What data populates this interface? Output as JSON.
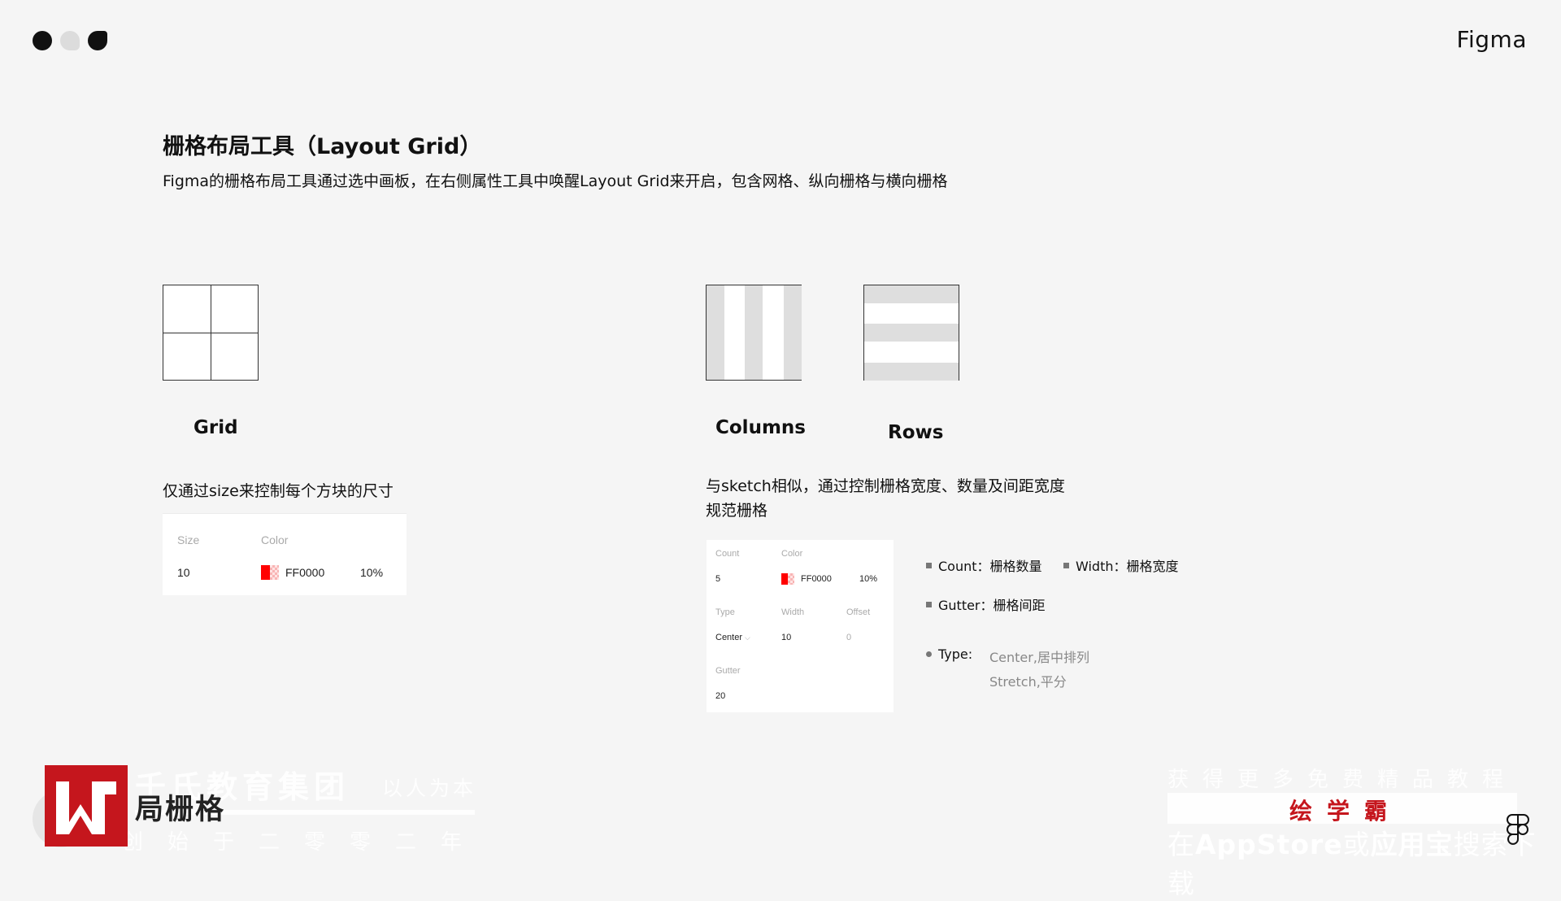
{
  "header": {
    "brand": "Figma"
  },
  "main": {
    "title": "栅格布局工具（Layout Grid）",
    "subtitle": "Figma的栅格布局工具通过选中画板，在右侧属性工具中唤醒Layout Grid来开启，包含网格、纵向栅格与横向栅格"
  },
  "grid_section": {
    "label": "Grid",
    "description": "仅通过size来控制每个方块的尺寸",
    "panel": {
      "size_label": "Size",
      "color_label": "Color",
      "size_value": "10",
      "color_value": "FF0000",
      "opacity_value": "10%"
    }
  },
  "columns_section": {
    "columns_label": "Columns",
    "rows_label": "Rows",
    "description_line1": "与sketch相似，通过控制栅格宽度、数量及间距宽度",
    "description_line2": "规范栅格",
    "panel": {
      "count_label": "Count",
      "color_label": "Color",
      "count_value": "5",
      "color_value": "FF0000",
      "opacity_value": "10%",
      "type_label": "Type",
      "width_label": "Width",
      "offset_label": "Offset",
      "type_value": "Center",
      "width_value": "10",
      "offset_value": "0",
      "gutter_label": "Gutter",
      "gutter_value": "20"
    },
    "legend": {
      "count": "Count：栅格数量",
      "width": "Width：栅格宽度",
      "gutter": "Gutter：栅格间距",
      "type_key": "Type:",
      "type_center": "Center,居中排列",
      "type_stretch": "Stretch,平分"
    }
  },
  "watermark": {
    "page_title": "局栅格",
    "company": "千氏教育集团",
    "slogan": "以人为本",
    "founded": "创始于二零零二年",
    "right_top": "获得更多免费精品教程",
    "right_brand": "绘学霸",
    "right_bottom_pre": "在",
    "right_bottom_store": "AppStore",
    "right_bottom_mid": "或",
    "right_bottom_app": "应用宝",
    "right_bottom_post": "搜索下载"
  }
}
